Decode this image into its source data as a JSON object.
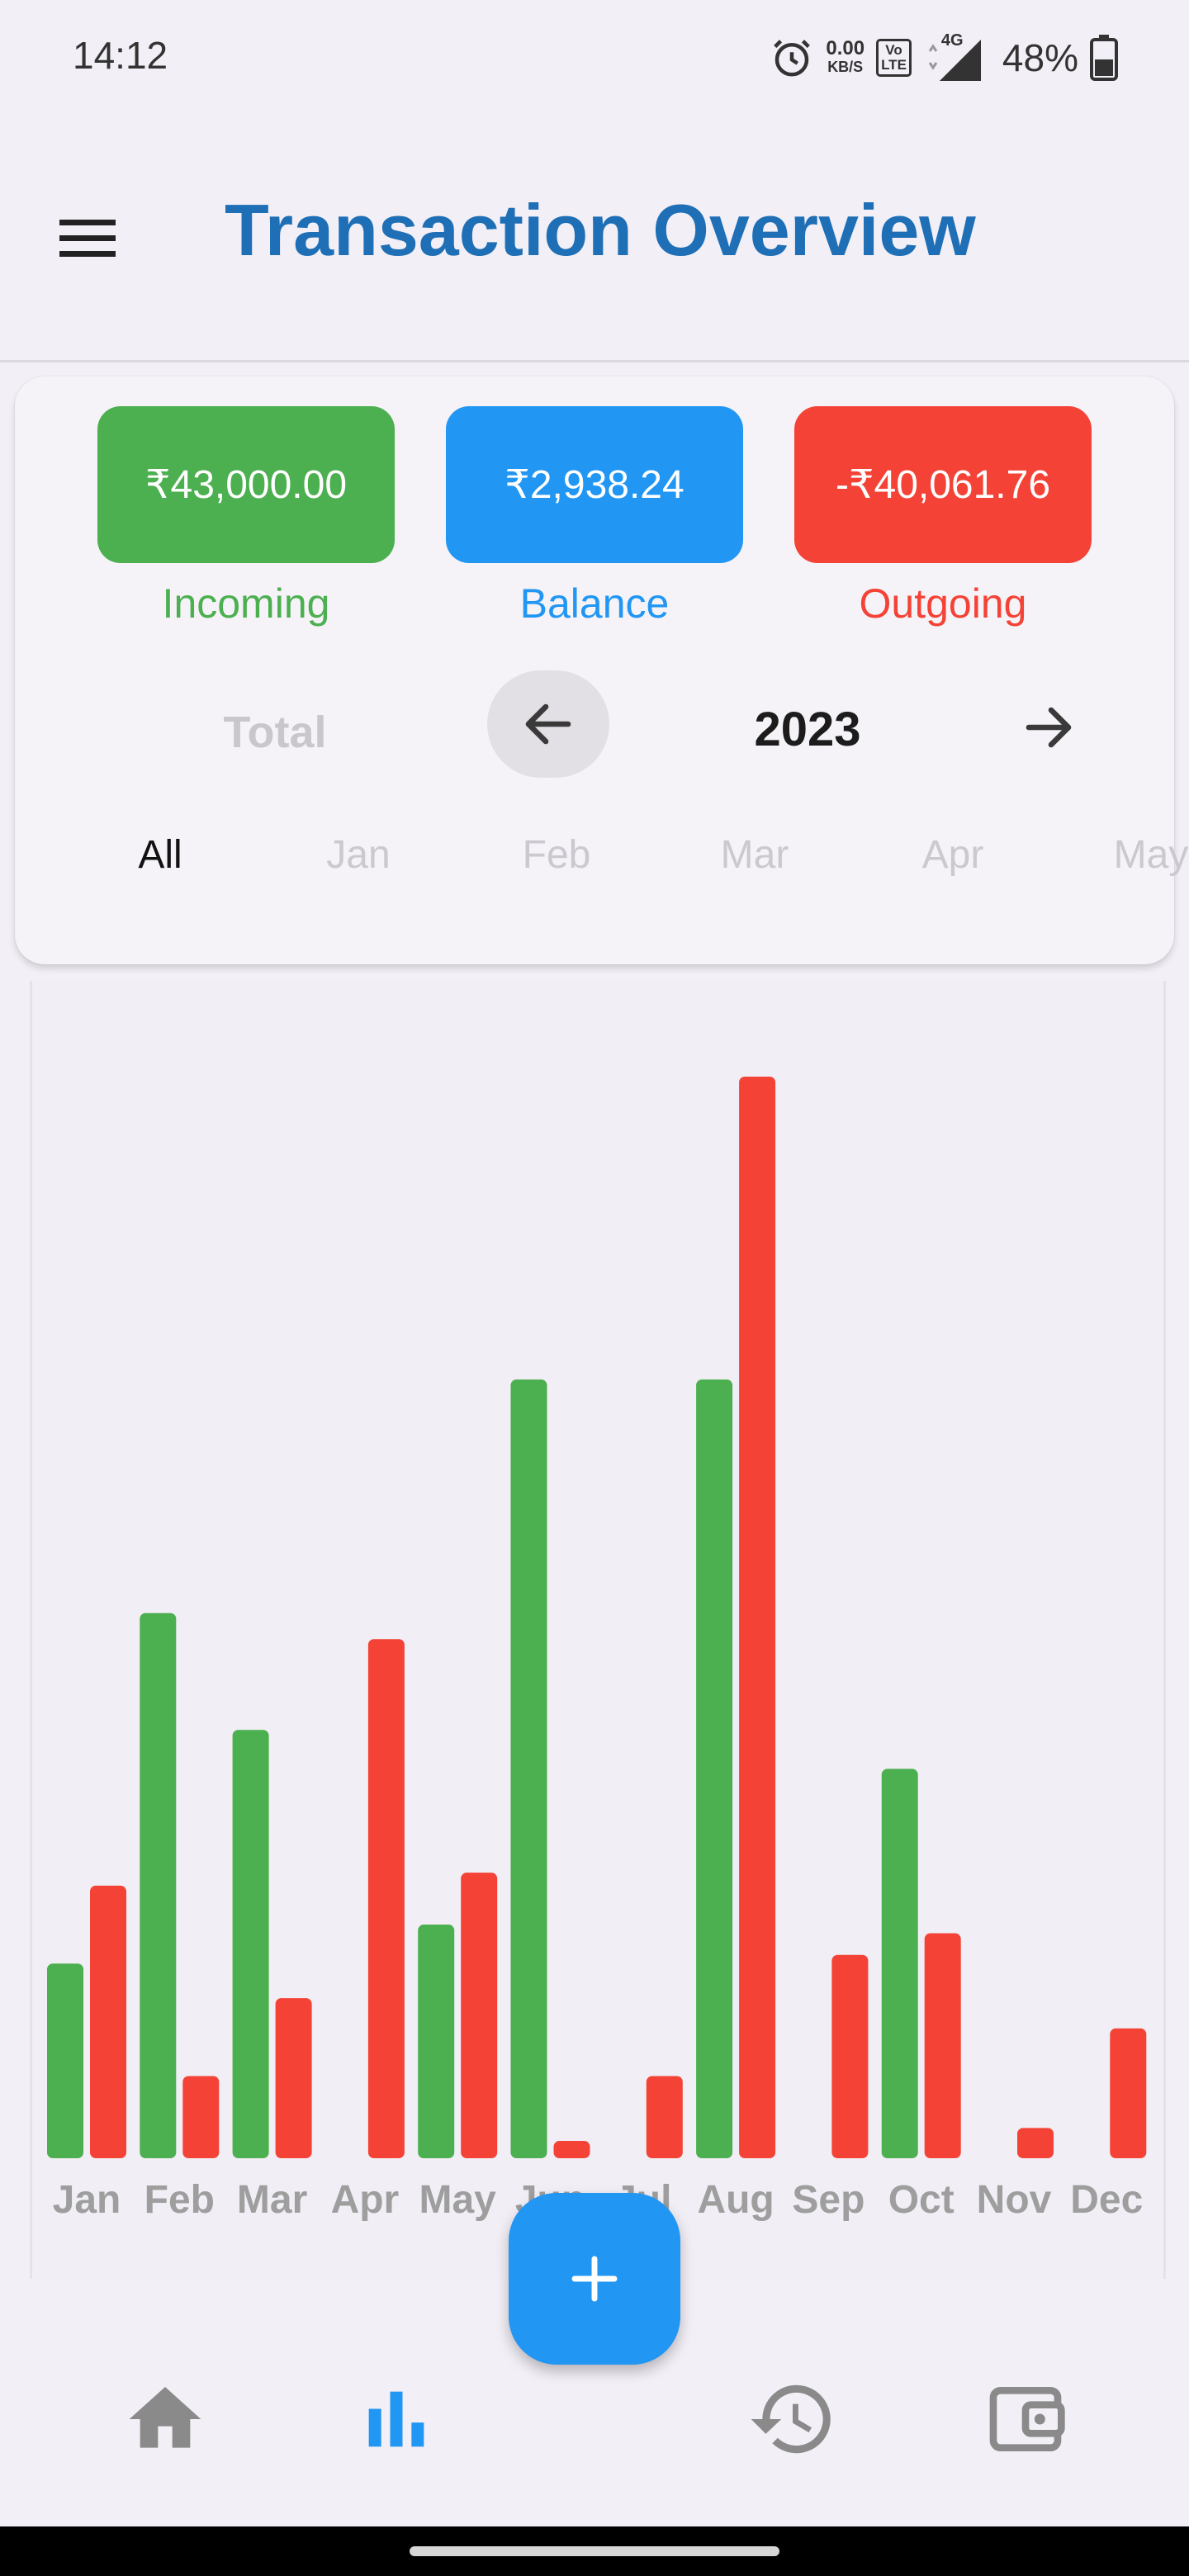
{
  "status_bar": {
    "time": "14:12",
    "net_speed_value": "0.00",
    "net_speed_unit": "KB/S",
    "volte_top": "Vo",
    "volte_bottom": "LTE",
    "network_type": "4G",
    "battery_percent": "48%"
  },
  "app_bar": {
    "title": "Transaction Overview",
    "menu_icon": "hamburger-menu-icon"
  },
  "summary": {
    "incoming": {
      "amount": "₹43,000.00",
      "label": "Incoming",
      "color": "#4caf50"
    },
    "balance": {
      "amount": "₹2,938.24",
      "label": "Balance",
      "color": "#2196f3"
    },
    "outgoing": {
      "amount": "-₹40,061.76",
      "label": "Outgoing",
      "color": "#f44336"
    }
  },
  "period": {
    "total_label": "Total",
    "year": "2023",
    "prev_icon": "arrow-left-icon",
    "next_icon": "arrow-right-icon"
  },
  "month_tabs": [
    "All",
    "Jan",
    "Feb",
    "Mar",
    "Apr",
    "May"
  ],
  "selected_tab": "All",
  "chart_data": {
    "type": "bar",
    "categories": [
      "Jan",
      "Feb",
      "Mar",
      "Apr",
      "May",
      "Jun",
      "Jul",
      "Aug",
      "Sep",
      "Oct",
      "Nov",
      "Dec"
    ],
    "series": [
      {
        "name": "Incoming",
        "color": "#4caf50",
        "values": [
          22.5,
          63,
          49.5,
          0,
          27,
          90,
          0,
          90,
          0,
          45,
          0,
          0
        ]
      },
      {
        "name": "Outgoing",
        "color": "#f44336",
        "values": [
          31.5,
          9.5,
          18.5,
          60,
          33,
          2,
          9.5,
          125,
          23.5,
          26,
          3.5,
          15
        ]
      }
    ],
    "ylim": [
      0,
      125
    ],
    "grid": false
  },
  "fab": {
    "icon": "plus-icon"
  },
  "bottom_nav": {
    "items": [
      {
        "icon": "home-icon",
        "active": false
      },
      {
        "icon": "bar-chart-icon",
        "active": true
      },
      {
        "icon": "history-icon",
        "active": false
      },
      {
        "icon": "wallet-icon",
        "active": false
      }
    ],
    "active_color": "#2196f3",
    "inactive_color": "#8a8a8a"
  }
}
